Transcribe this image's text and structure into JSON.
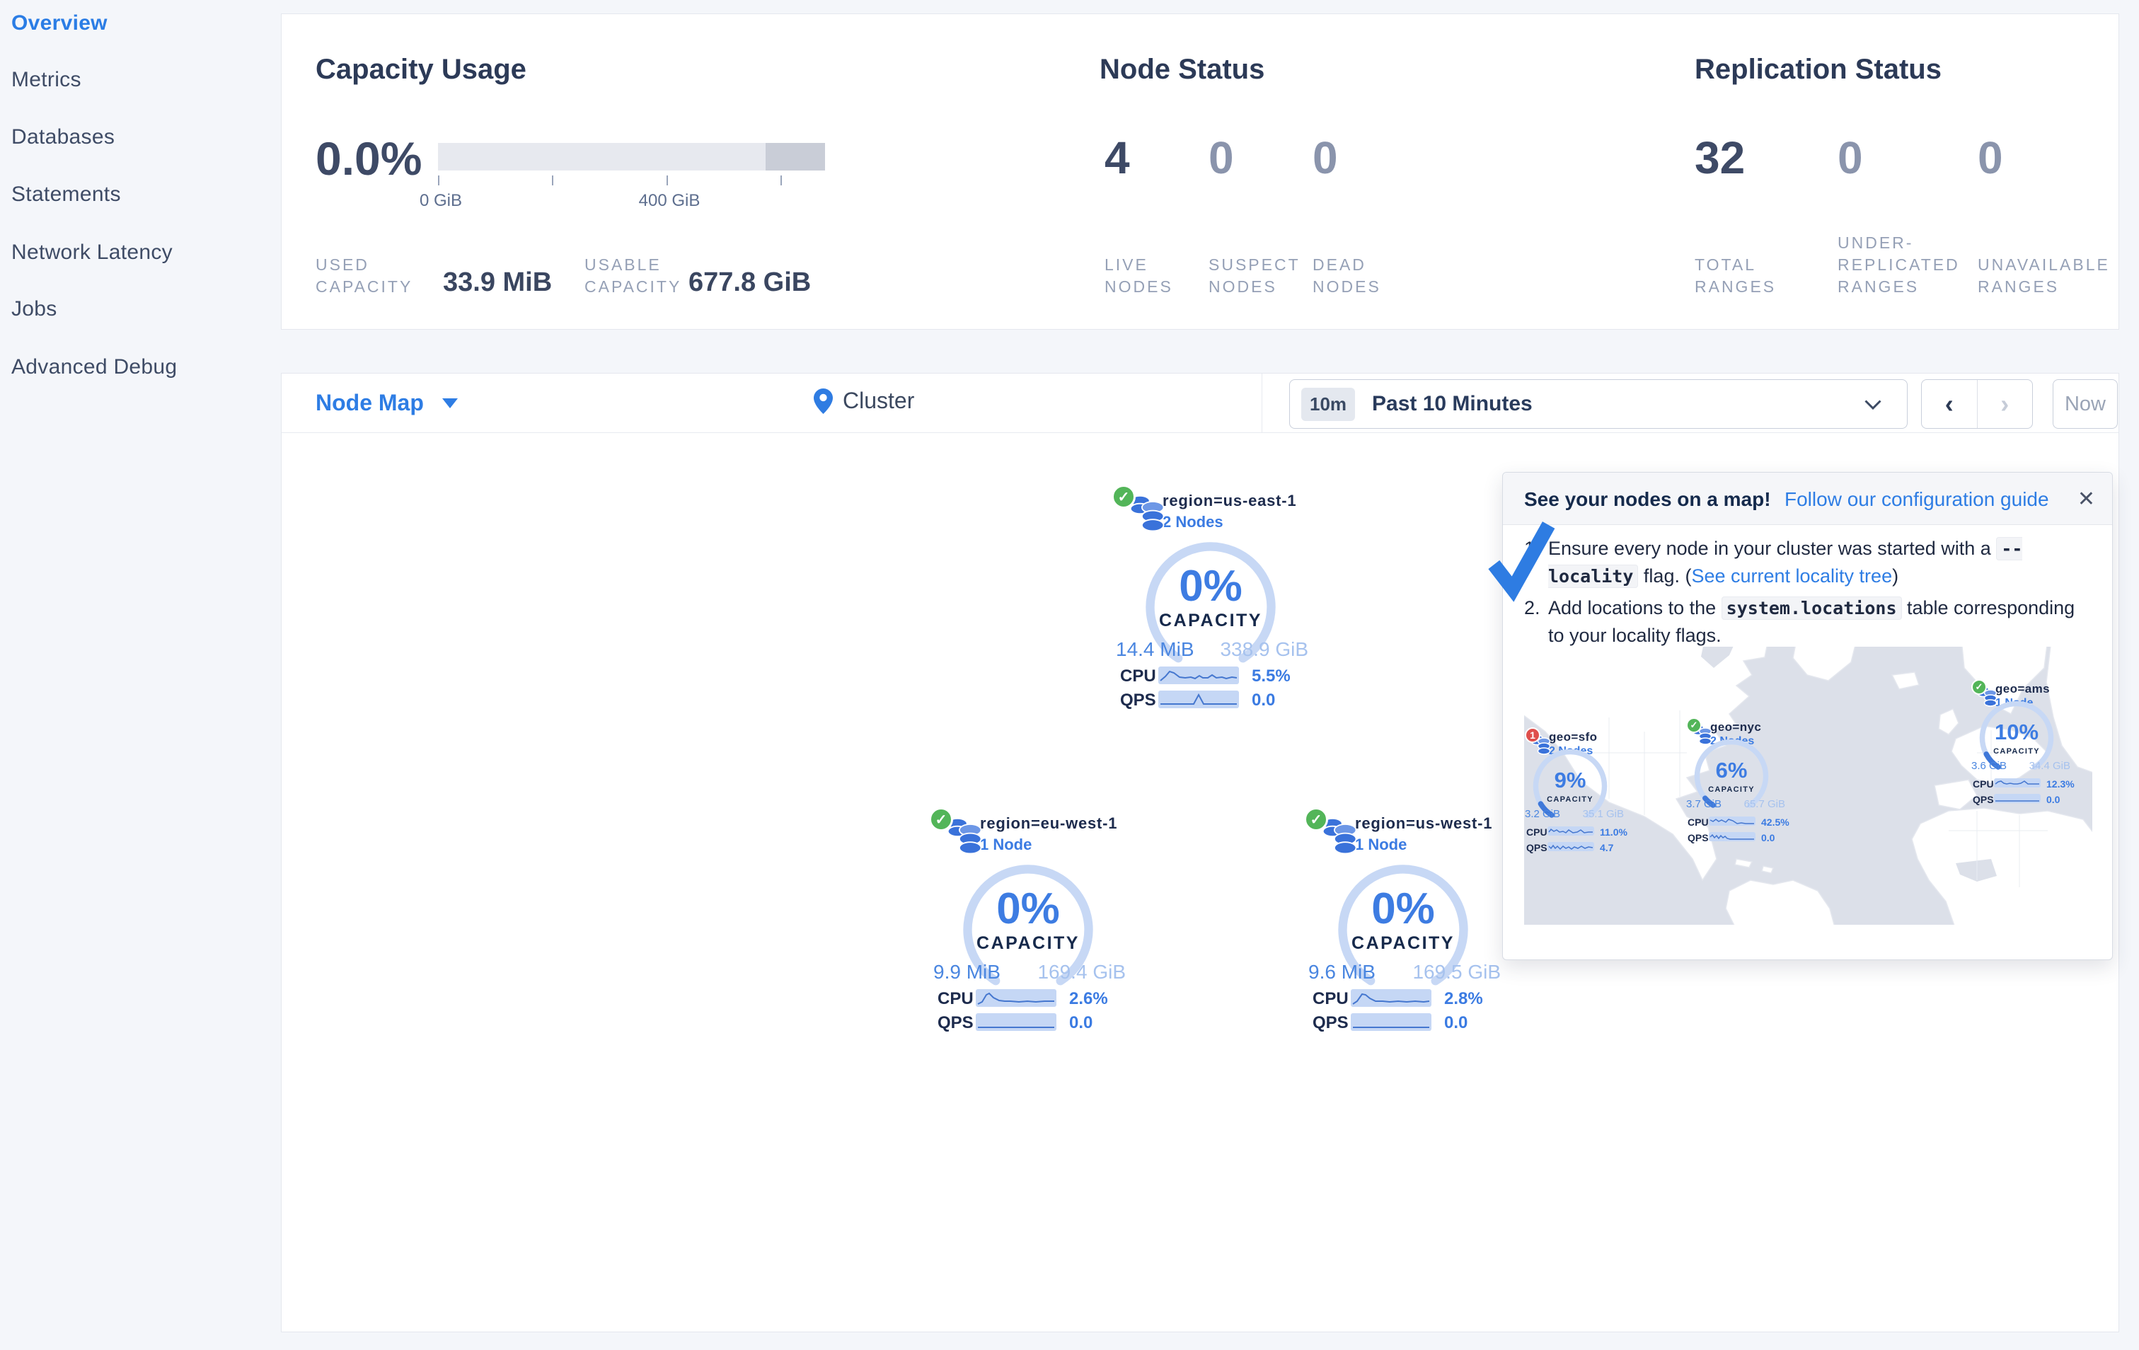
{
  "sidebar": {
    "items": [
      {
        "label": "Overview",
        "active": true
      },
      {
        "label": "Metrics",
        "active": false
      },
      {
        "label": "Databases",
        "active": false
      },
      {
        "label": "Statements",
        "active": false
      },
      {
        "label": "Network Latency",
        "active": false
      },
      {
        "label": "Jobs",
        "active": false
      },
      {
        "label": "Advanced Debug",
        "active": false
      }
    ]
  },
  "labels": {
    "cpu": "CPU",
    "qps": "QPS",
    "capacity": "CAPACITY"
  },
  "capacity": {
    "title": "Capacity Usage",
    "percent": "0.0%",
    "tick0": "0 GiB",
    "tick400": "400 GiB",
    "used_label": "USED CAPACITY",
    "used_value": "33.9 MiB",
    "usable_label": "USABLE CAPACITY",
    "usable_value": "677.8 GiB"
  },
  "node_status": {
    "title": "Node Status",
    "live_value": "4",
    "live_label": "LIVE NODES",
    "suspect_value": "0",
    "suspect_label": "SUSPECT NODES",
    "dead_value": "0",
    "dead_label": "DEAD NODES"
  },
  "replication": {
    "title": "Replication Status",
    "total_value": "32",
    "total_label": "TOTAL RANGES",
    "under_value": "0",
    "under_label": "UNDER-REPLICATED RANGES",
    "unavail_value": "0",
    "unavail_label": "UNAVAILABLE RANGES"
  },
  "toolbar": {
    "view_label": "Node Map",
    "breadcrumb": "Cluster",
    "time_badge": "10m",
    "time_label": "Past 10 Minutes",
    "prev": "‹",
    "next": "›",
    "now_label": "Now"
  },
  "nodes": [
    {
      "title": "region=us-east-1",
      "nodes": "2 Nodes",
      "pct": "0%",
      "used": "14.4 MiB",
      "total": "338.9 GiB",
      "cpu": "5.5%",
      "qps": "0.0"
    },
    {
      "title": "region=eu-west-1",
      "nodes": "1 Node",
      "pct": "0%",
      "used": "9.9 MiB",
      "total": "169.4 GiB",
      "cpu": "2.6%",
      "qps": "0.0"
    },
    {
      "title": "region=us-west-1",
      "nodes": "1 Node",
      "pct": "0%",
      "used": "9.6 MiB",
      "total": "169.5 GiB",
      "cpu": "2.8%",
      "qps": "0.0"
    }
  ],
  "map_nodes": [
    {
      "title": "geo=sfo",
      "nodes": "2 Nodes",
      "badge": "1",
      "pct": "9%",
      "used": "3.2 GiB",
      "total": "35.1 GiB",
      "cpu": "11.0%",
      "qps": "4.7"
    },
    {
      "title": "geo=nyc",
      "nodes": "2 Nodes",
      "pct": "6%",
      "used": "3.7 GiB",
      "total": "65.7 GiB",
      "cpu": "42.5%",
      "qps": "0.0"
    },
    {
      "title": "geo=ams",
      "nodes": "1 Node",
      "pct": "10%",
      "used": "3.6 GiB",
      "total": "34.4 GiB",
      "cpu": "12.3%",
      "qps": "0.0"
    }
  ],
  "guide": {
    "title": "See your nodes on a map!",
    "link": "Follow our configuration guide",
    "close": "✕",
    "step1_num": "1.",
    "step1_pre": "Ensure every node in your cluster was started with a ",
    "step1_code": "--locality",
    "step1_mid": " flag. (",
    "step1_link": "See current locality tree",
    "step1_post": ")",
    "step2_num": "2.",
    "step2_pre": "Add locations to the ",
    "step2_code": "system.locations",
    "step2_post": " table corresponding to your locality flags."
  }
}
